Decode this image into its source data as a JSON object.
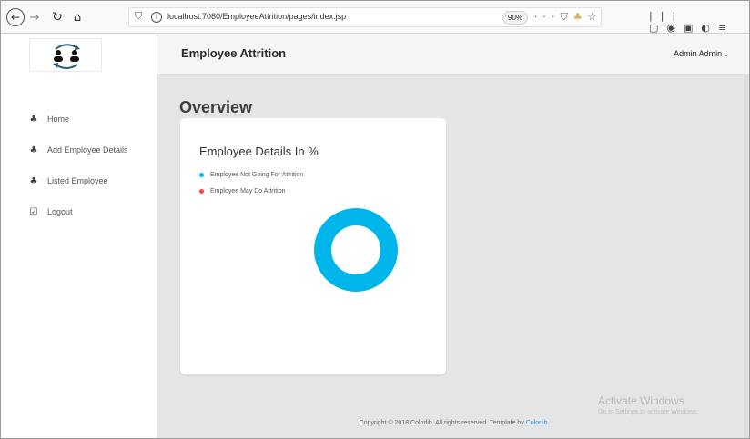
{
  "browser": {
    "url": "localhost:7080/EmployeeAttrition/pages/index.jsp",
    "zoom": "90%",
    "more": "···"
  },
  "app": {
    "title": "Employee Attrition",
    "user_menu": "Admin Admin"
  },
  "sidebar": {
    "items": [
      {
        "label": "Home",
        "icon": "users-icon"
      },
      {
        "label": "Add Employee Details",
        "icon": "users-icon"
      },
      {
        "label": "Listed Employee",
        "icon": "users-icon"
      },
      {
        "label": "Logout",
        "icon": "checkbox-icon"
      }
    ]
  },
  "main": {
    "section_title": "Overview"
  },
  "card": {
    "title": "Employee Details In %"
  },
  "chart_data": {
    "type": "pie",
    "title": "Employee Details In %",
    "categories": [
      "Employee Not Going For Attrition",
      "Employee May Do Attrition"
    ],
    "values": [
      100,
      0
    ],
    "colors": [
      "#00b5e9",
      "#fa4251"
    ],
    "legend_placement": "top-left",
    "donut": true
  },
  "footer": {
    "text": "Copyright © 2018 Colorlib. All rights reserved. Template by ",
    "link": "Colorlib",
    "suffix": "."
  },
  "watermark": {
    "title": "Activate Windows",
    "subtitle": "Go to Settings to activate Windows."
  },
  "colors": {
    "accent": "#00b5e9",
    "danger": "#fa4251",
    "main_bg": "#e5e5e5"
  }
}
